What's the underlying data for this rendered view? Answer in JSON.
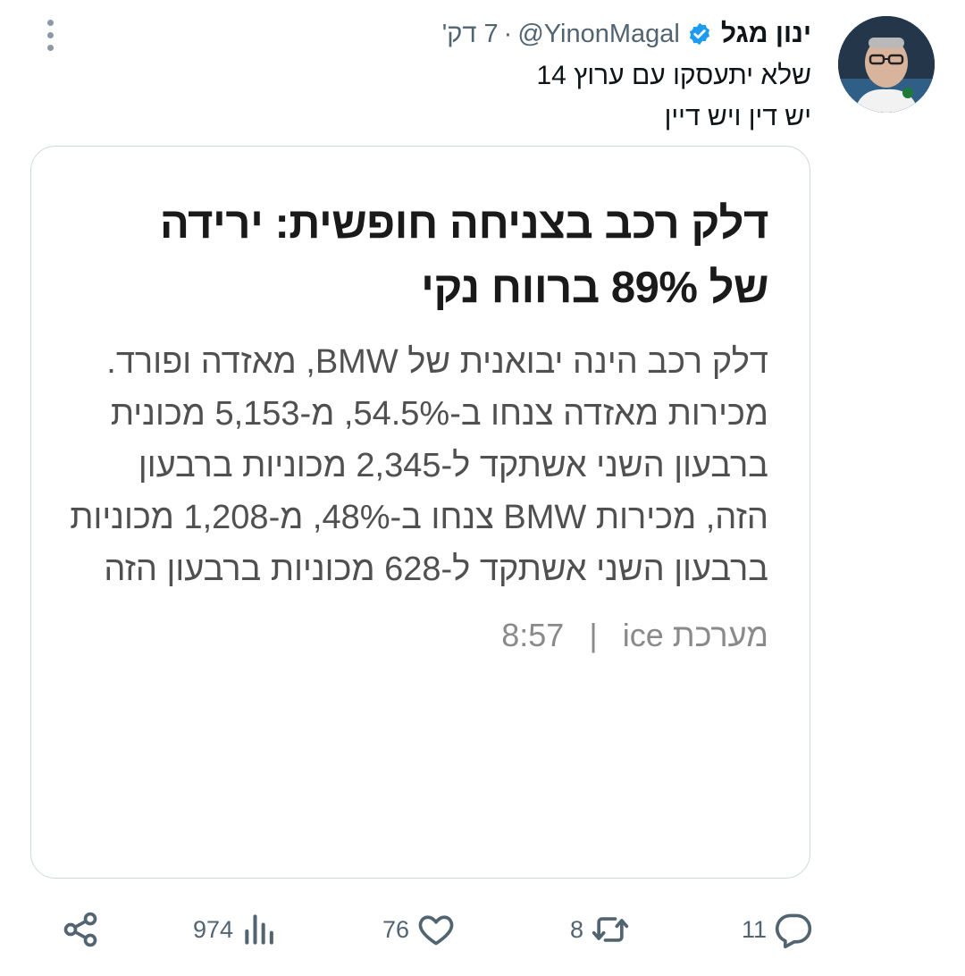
{
  "author": {
    "name": "ינון מגל",
    "handle": "@YinonMagal",
    "separator": "·",
    "time": "7 דק'",
    "verified": true
  },
  "tweet": {
    "lines": [
      "שלא יתעסקו עם ערוץ 14",
      "יש דין ויש דיין"
    ]
  },
  "card": {
    "title_lines": [
      "דלק רכב בצניחה חופשית: ירידה",
      "של 89% ברווח נקי"
    ],
    "body": "דלק רכב הינה יבואנית של BMW, מאזדה ופורד. מכירות מאזדה צנחו ב-54.5%, מ-5,153 מכונית ברבעון השני אשתקד ל-2,345 מכוניות ברבעון הזה, מכירות BMW צנחו ב-48%, מ-1,208 מכוניות ברבעון השני אשתקד ל-628 מכוניות ברבעון הזה",
    "source": "מערכת ice",
    "divider": "|",
    "time": "8:57"
  },
  "actions": {
    "replies": "11",
    "retweets": "8",
    "likes": "76",
    "views": "974"
  },
  "colors": {
    "verified": "#1d9bf0",
    "muted": "#536471",
    "border": "#cfd9de"
  }
}
